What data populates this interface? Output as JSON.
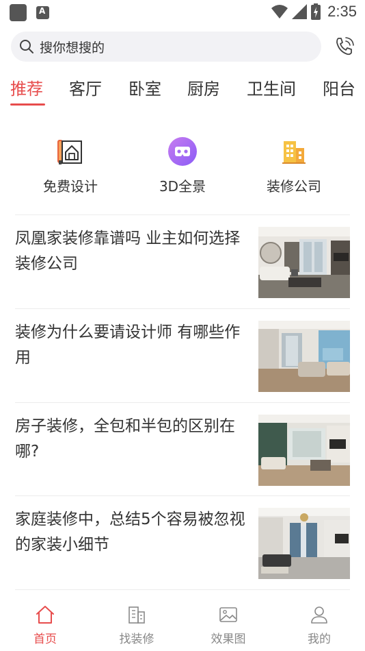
{
  "status_bar": {
    "time": "2:35"
  },
  "search": {
    "placeholder": "搜你想搜的"
  },
  "tabs": [
    {
      "label": "推荐",
      "active": true
    },
    {
      "label": "客厅",
      "active": false
    },
    {
      "label": "卧室",
      "active": false
    },
    {
      "label": "厨房",
      "active": false
    },
    {
      "label": "卫生间",
      "active": false
    },
    {
      "label": "阳台",
      "active": false
    }
  ],
  "quick_entries": [
    {
      "label": "免费设计",
      "icon": "blueprint-house-icon"
    },
    {
      "label": "3D全景",
      "icon": "vr-goggles-icon"
    },
    {
      "label": "装修公司",
      "icon": "building-icon"
    }
  ],
  "articles": [
    {
      "title": "凤凰家装修靠谱吗 业主如何选择装修公司",
      "image": "living-room-photo"
    },
    {
      "title": "装修为什么要请设计师 有哪些作用",
      "image": "living-room-photo"
    },
    {
      "title": "房子装修，全包和半包的区别在哪?",
      "image": "living-room-photo"
    },
    {
      "title": "家庭装修中，总结5个容易被忽视的家装小细节",
      "image": "living-room-photo"
    }
  ],
  "bottom_nav": [
    {
      "label": "首页",
      "icon": "home-icon",
      "active": true
    },
    {
      "label": "找装修",
      "icon": "building-outline-icon",
      "active": false
    },
    {
      "label": "效果图",
      "icon": "image-icon",
      "active": false
    },
    {
      "label": "我的",
      "icon": "user-icon",
      "active": false
    }
  ],
  "colors": {
    "accent": "#e74c4c",
    "text": "#333333",
    "muted": "#888888",
    "search_bg": "#f2f2f5"
  }
}
